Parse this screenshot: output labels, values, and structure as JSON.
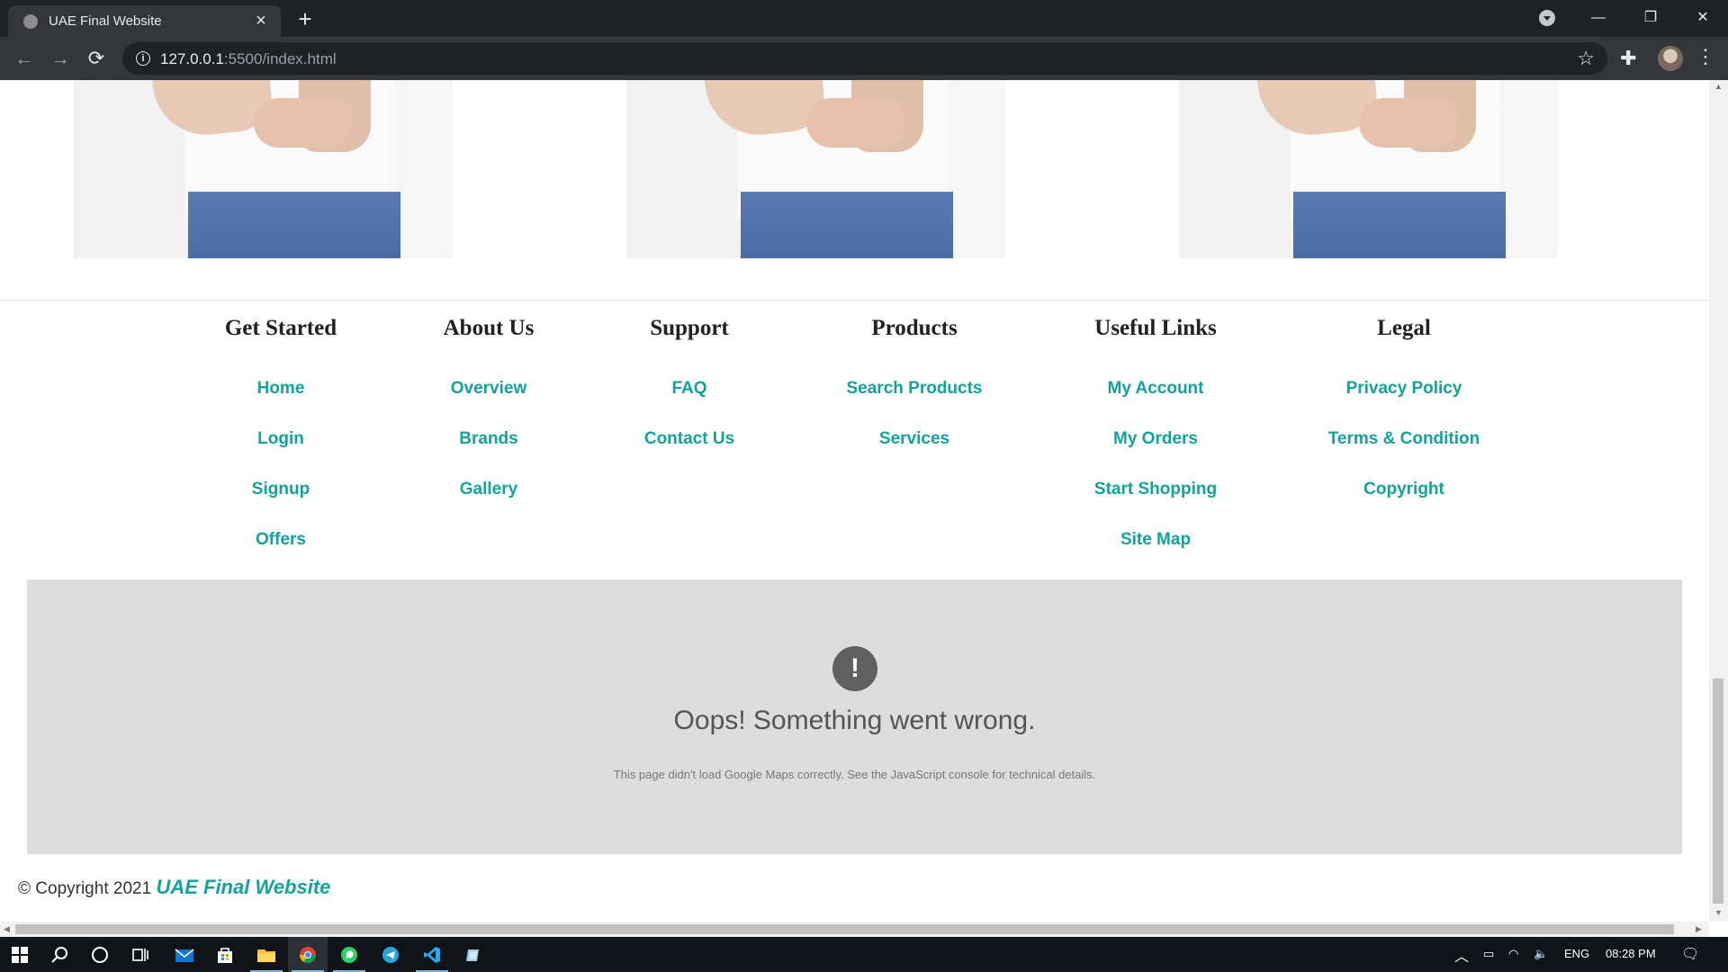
{
  "browser": {
    "tab_title": "UAE Final Website",
    "tab_close": "×",
    "new_tab": "+",
    "url_host": "127.0.0.1",
    "url_path": ":5500/index.html",
    "icons": {
      "back": "←",
      "forward": "→",
      "reload": "⟳",
      "info": "i",
      "star": "☆",
      "extensions": "✚",
      "menu": "⋮",
      "minimize": "—",
      "restore": "❐",
      "close": "✕"
    }
  },
  "footer": {
    "columns": [
      {
        "title": "Get Started",
        "links": [
          "Home",
          "Login",
          "Signup",
          "Offers"
        ]
      },
      {
        "title": "About Us",
        "links": [
          "Overview",
          "Brands",
          "Gallery"
        ]
      },
      {
        "title": "Support",
        "links": [
          "FAQ",
          "Contact Us"
        ]
      },
      {
        "title": "Products",
        "links": [
          "Search Products",
          "Services"
        ]
      },
      {
        "title": "Useful Links",
        "links": [
          "My Account",
          "My Orders",
          "Start Shopping",
          "Site Map"
        ]
      },
      {
        "title": "Legal",
        "links": [
          "Privacy Policy",
          "Terms & Condition",
          "Copyright"
        ]
      }
    ],
    "link_color": "#12a39b"
  },
  "map_error": {
    "icon": "!",
    "title": "Oops! Something went wrong.",
    "description": "This page didn't load Google Maps correctly. See the JavaScript console for technical details."
  },
  "copyright": {
    "symbol": "©",
    "text": "Copyright 2021",
    "brand": "UAE Final Website"
  },
  "taskbar": {
    "language": "ENG",
    "time": "08:28 PM"
  }
}
